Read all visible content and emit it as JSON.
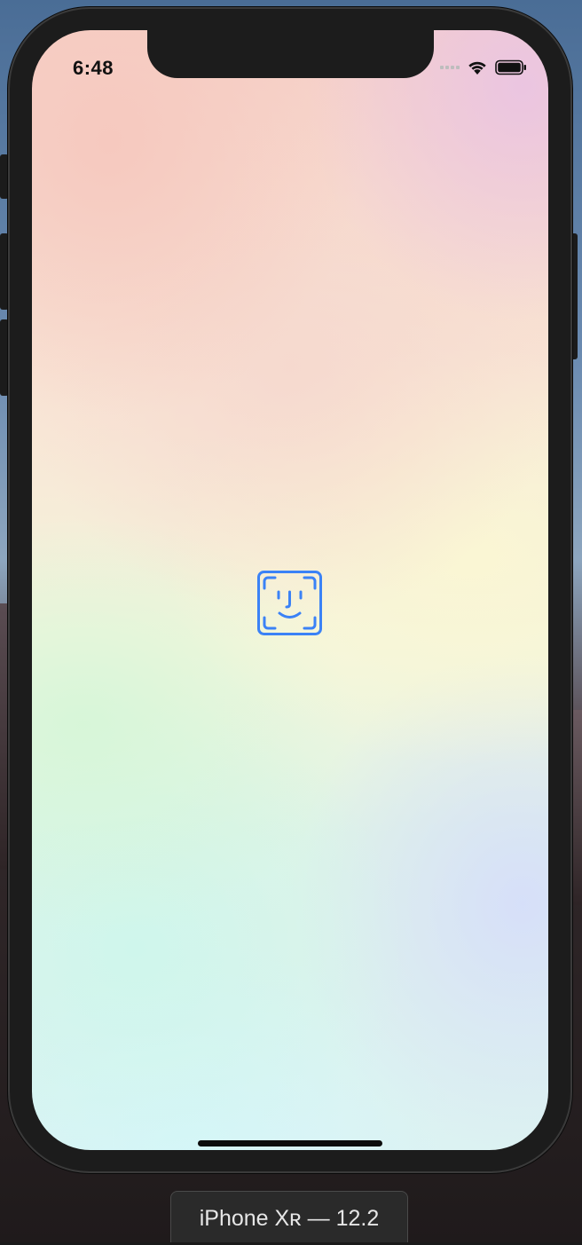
{
  "status_bar": {
    "time": "6:48",
    "icons": [
      "signal-icon",
      "wifi-icon",
      "battery-icon"
    ]
  },
  "content": {
    "center_icon": "face-id-icon",
    "accent_color": "#3b82f6"
  },
  "simulator": {
    "device_label": "iPhone Xʀ — 12.2"
  }
}
